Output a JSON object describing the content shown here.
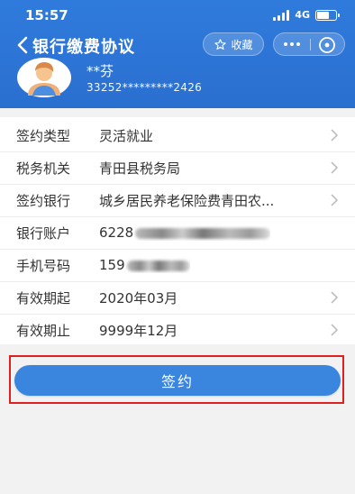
{
  "status_bar": {
    "time": "15:57",
    "network": "4G",
    "battery_level": 0.7
  },
  "navbar": {
    "title": "银行缴费协议",
    "favorite_label": "收藏",
    "icons": {
      "back": "chevron-left-icon",
      "favorite": "star-icon",
      "more": "more-dots-icon",
      "close": "close-circle-icon"
    }
  },
  "profile": {
    "name": "**芬",
    "id_number": "33252*********2426",
    "avatar_icon": "user-avatar-icon"
  },
  "info_rows": [
    {
      "label": "签约类型",
      "value": "灵活就业",
      "has_arrow": true
    },
    {
      "label": "税务机关",
      "value": "青田县税务局",
      "has_arrow": true
    },
    {
      "label": "签约银行",
      "value": "城乡居民养老保险费青田农...",
      "has_arrow": true
    },
    {
      "label": "银行账户",
      "value": "6228",
      "has_arrow": false
    },
    {
      "label": "手机号码",
      "value": "159",
      "has_arrow": false
    },
    {
      "label": "有效期起",
      "value": "2020年03月",
      "has_arrow": true
    },
    {
      "label": "有效期止",
      "value": "9999年12月",
      "has_arrow": true
    }
  ],
  "sign_button_label": "签约",
  "colors": {
    "header_blue": "#2f7bdc",
    "button_blue": "#3a86de",
    "highlight_red": "#e02020"
  }
}
